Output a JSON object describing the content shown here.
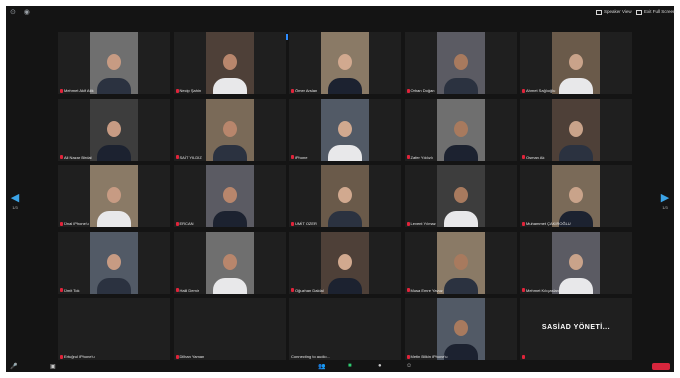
{
  "toolbar": {
    "speaker_view_label": "Speaker View",
    "full_screen_label": "Exit Full Screen",
    "nav_left_icon": "chevron-left-icon",
    "nav_right_icon": "chevron-right-icon",
    "page_left": "1/3",
    "page_right": "1/3"
  },
  "participants": [
    {
      "name": "Mehmet Akif Atik",
      "muted": true
    },
    {
      "name": "Necip Şahin",
      "muted": true
    },
    {
      "name": "Ömer Arslan",
      "muted": true
    },
    {
      "name": "Orhan Doğan",
      "muted": true
    },
    {
      "name": "Ahmet Sağlıoğlu",
      "muted": true
    },
    {
      "name": "Ali Nazar Birdal",
      "muted": true
    },
    {
      "name": "SAİT YILDIZ",
      "muted": true
    },
    {
      "name": "iPhone",
      "muted": true
    },
    {
      "name": "Zafer Yıldızlı",
      "muted": true
    },
    {
      "name": "Osman Ak",
      "muted": true
    },
    {
      "name": "Ünal iPhone'u",
      "muted": true
    },
    {
      "name": "ERCAN",
      "muted": true
    },
    {
      "name": "UMİT OZER",
      "muted": true
    },
    {
      "name": "Levent Yılmaz",
      "muted": true
    },
    {
      "name": "Muhammet ÇAKIROĞLU",
      "muted": true
    },
    {
      "name": "Ümit Tok",
      "muted": true
    },
    {
      "name": "Halil Demir",
      "muted": true
    },
    {
      "name": "Oğuzhan Daldal",
      "muted": true
    },
    {
      "name": "Musa Emre Yavuz",
      "muted": true
    },
    {
      "name": "Mehmet Kılıçaslan",
      "muted": true
    },
    {
      "name": "Ertuğrul iPhone'u",
      "muted": true
    },
    {
      "name": "Dilhan Yaman",
      "muted": true
    },
    {
      "name": "Connecting to audio...",
      "muted": false
    },
    {
      "name": "Metin Bilkin iPhone'u",
      "muted": true
    },
    {
      "name": "",
      "muted": true,
      "label": "SASİAD YÖNETİ..."
    }
  ]
}
